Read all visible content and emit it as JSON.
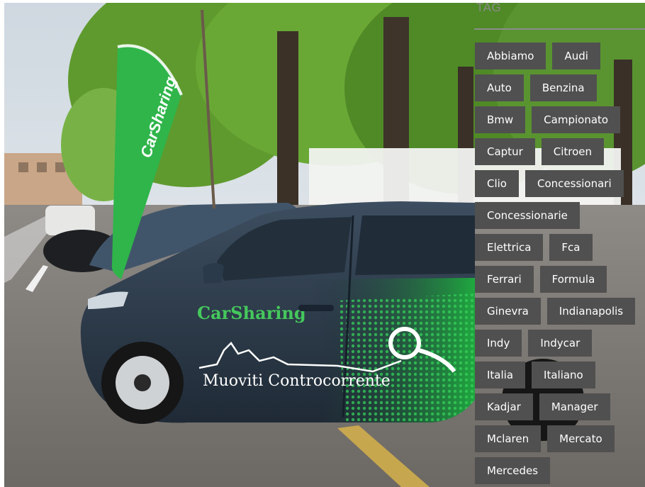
{
  "photo": {
    "flag_text": "CarSharing",
    "car_text": "CarSharing",
    "door_text": "Muoviti Controcorrente",
    "colors": {
      "car_body": "#2b3a4a",
      "brand_green": "#2fb54a",
      "sky": "#e8ecef",
      "foliage": "#5f9a2e"
    }
  },
  "tag_widget": {
    "title": "TAG",
    "tags": [
      {
        "label": "Abbiamo"
      },
      {
        "label": "Audi"
      },
      {
        "label": "Auto"
      },
      {
        "label": "Benzina"
      },
      {
        "label": "Bmw"
      },
      {
        "label": "Campionato"
      },
      {
        "label": "Captur"
      },
      {
        "label": "Citroen"
      },
      {
        "label": "Clio"
      },
      {
        "label": "Concessionari"
      },
      {
        "label": "Concessionarie"
      },
      {
        "label": "Elettrica"
      },
      {
        "label": "Fca"
      },
      {
        "label": "Ferrari"
      },
      {
        "label": "Formula"
      },
      {
        "label": "Ginevra"
      },
      {
        "label": "Indianapolis"
      },
      {
        "label": "Indy"
      },
      {
        "label": "Indycar"
      },
      {
        "label": "Italia"
      },
      {
        "label": "Italiano"
      },
      {
        "label": "Kadjar"
      },
      {
        "label": "Manager"
      },
      {
        "label": "Mclaren"
      },
      {
        "label": "Mercato"
      },
      {
        "label": "Mercedes"
      }
    ],
    "colors": {
      "tag_bg": "#505050",
      "tag_text": "#ffffff",
      "title": "#8a8a8a"
    }
  }
}
